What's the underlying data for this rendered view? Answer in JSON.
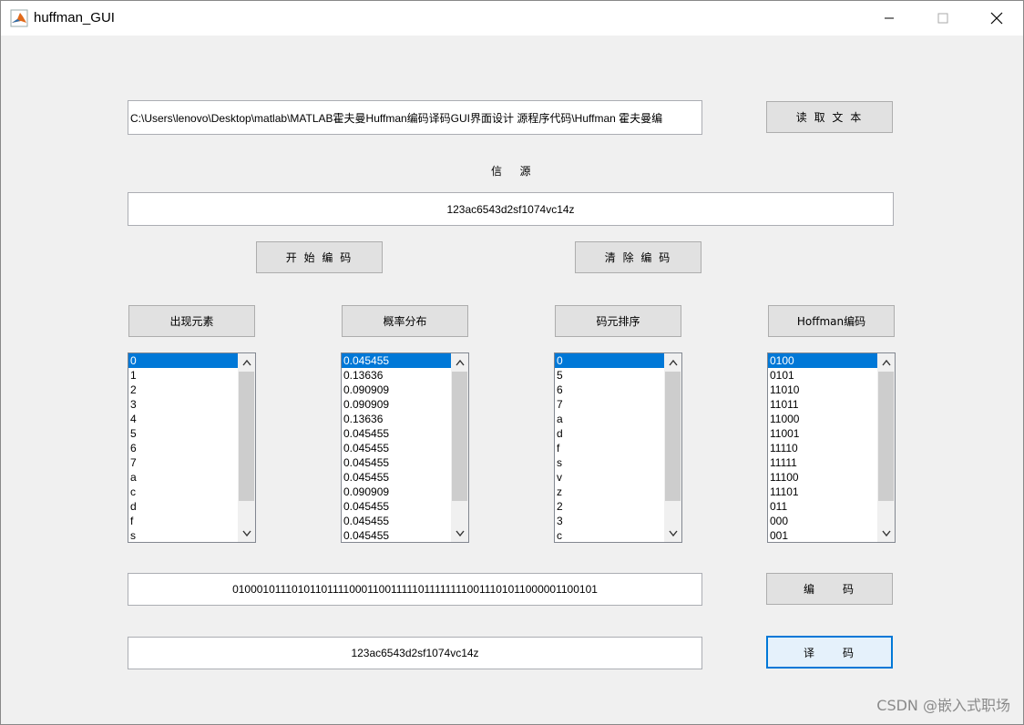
{
  "window": {
    "title": "huffman_GUI"
  },
  "file_path": {
    "value": "C:\\Users\\lenovo\\Desktop\\matlab\\MATLAB霍夫曼Huffman编码译码GUI界面设计 源程序代码\\Huffman 霍夫曼编"
  },
  "buttons": {
    "read_text": "读 取 文 本",
    "start_encode": "开 始 编 码",
    "clear_encode": "清 除 编 码",
    "elements": "出现元素",
    "probability": "概率分布",
    "symbol_sort": "码元排序",
    "huffman_code": "Hoffman编码",
    "encode": "编     码",
    "decode": "译     码"
  },
  "source": {
    "label": "信   源",
    "value": "123ac6543d2sf1074vc14z"
  },
  "lists": {
    "elements": [
      "0",
      "1",
      "2",
      "3",
      "4",
      "5",
      "6",
      "7",
      "a",
      "c",
      "d",
      "f",
      "s"
    ],
    "probability": [
      "0.045455",
      "0.13636",
      "0.090909",
      "0.090909",
      "0.13636",
      "0.045455",
      "0.045455",
      "0.045455",
      "0.045455",
      "0.090909",
      "0.045455",
      "0.045455",
      "0.045455"
    ],
    "symbol_sort": [
      "0",
      "5",
      "6",
      "7",
      "a",
      "d",
      "f",
      "s",
      "v",
      "z",
      "2",
      "3",
      "c"
    ],
    "huffman_code": [
      "0100",
      "0101",
      "11010",
      "11011",
      "11000",
      "11001",
      "11110",
      "11111",
      "11100",
      "11101",
      "011",
      "000",
      "001"
    ]
  },
  "encoded": {
    "value": "010001011101011011110001100111110111111110011101011000001100101"
  },
  "decoded": {
    "value": "123ac6543d2sf1074vc14z"
  },
  "watermark": "CSDN @嵌入式职场",
  "colors": {
    "selection": "#0078d7",
    "background": "#f0f0f0",
    "button": "#e1e1e1"
  }
}
